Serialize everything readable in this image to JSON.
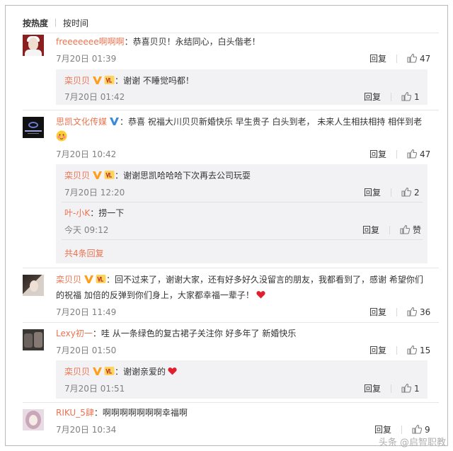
{
  "sort": {
    "active": "按热度",
    "other": "按时间"
  },
  "colon": "：",
  "comments": [
    {
      "user": "freeeeeee啊啊啊",
      "text": "恭喜贝贝！永结同心，白头偕老！",
      "time": "7月20日 01:39",
      "reply_label": "回复",
      "likes": "47"
    },
    {
      "user": "思凯文化传媒",
      "text": "恭喜 祝福大川贝贝新婚快乐 早生贵子 白头到老， 未来人生相扶相持 相伴到老",
      "time": "7月20日 10:42",
      "reply_label": "回复",
      "likes": "47"
    },
    {
      "user": "栾贝贝",
      "text_line1": "回不过来了，谢谢大家，还有好多好久没留言的朋友，我都看到了，感谢 希望你们",
      "text_line2": "的祝福 加倍的反弹到你们身上，大家都幸福一辈子！",
      "time": "7月20日 11:49",
      "reply_label": "回复",
      "likes": "36"
    },
    {
      "user": "Lexy初一",
      "text": "哇 从一条绿色的复古裙子关注你 好多年了  新婚快乐",
      "time": "7月20日 01:50",
      "reply_label": "回复",
      "likes": "15"
    },
    {
      "user": "RIKU_5肆",
      "text": "啊啊啊啊啊啊啊幸福啊",
      "time": "7月20日 10:34",
      "reply_label": "回复",
      "likes": "9"
    }
  ],
  "replies": [
    {
      "user": "栾贝贝",
      "text": "谢谢 不睡觉吗都！",
      "time": "7月20日 01:42",
      "reply_label": "回复",
      "likes": "1"
    },
    {
      "user": "栾贝贝",
      "text": "谢谢思凯哈哈哈下次再去公司玩耍",
      "time": "7月20日 12:20",
      "reply_label": "回复",
      "likes": "2"
    },
    {
      "user": "叶-小K",
      "text": "捞一下",
      "time": "今天 09:12",
      "reply_label": "回复",
      "likes": "赞"
    },
    {
      "user": "栾贝贝",
      "text": "谢谢亲爱的",
      "time": "7月20日 01:51",
      "reply_label": "回复",
      "likes": "1"
    }
  ],
  "more_replies": "共4条回复",
  "watermark": "头条 @启智职教",
  "colors": {
    "name": "#eb7350",
    "text": "#333333",
    "time": "#808080",
    "reply_bg": "#f2f2f5",
    "verified": "#ff9e1b",
    "heart": "#e0202e"
  }
}
